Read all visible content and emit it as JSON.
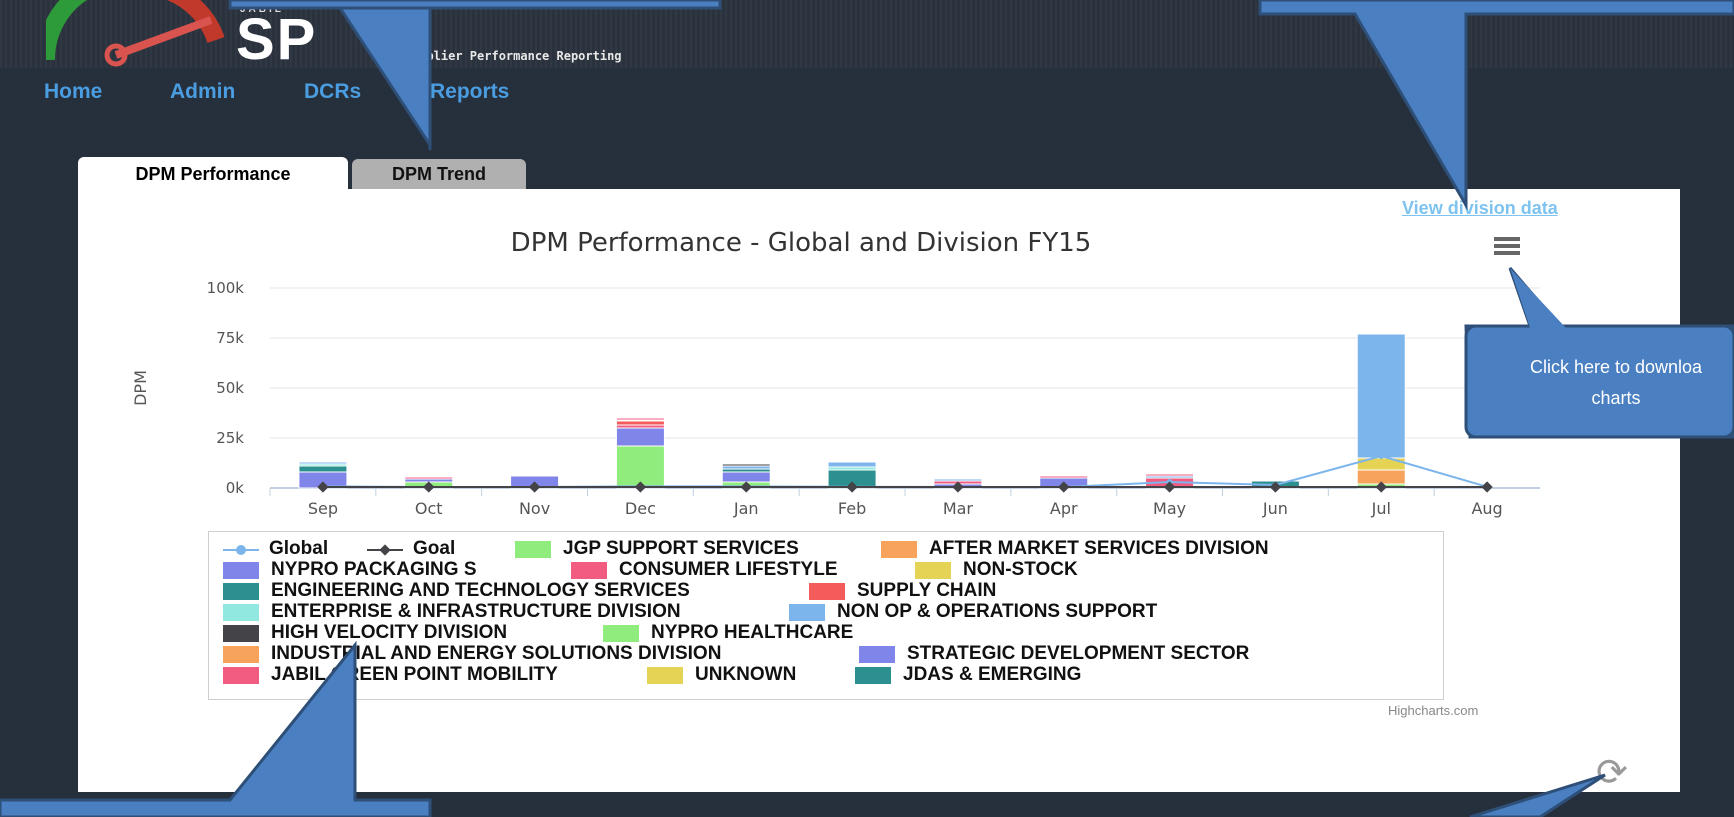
{
  "app": {
    "brand": "SP",
    "brand_company": "JABIL",
    "tagline": "upplier Performance Reporting"
  },
  "nav": {
    "items": [
      "Home",
      "Admin",
      "DCRs",
      "Reports"
    ]
  },
  "tabs": [
    {
      "label": "DPM Performance",
      "active": true
    },
    {
      "label": "DPM Trend",
      "active": false
    }
  ],
  "links": {
    "view_division": "View division data"
  },
  "chart_data": {
    "type": "bar",
    "title": "DPM Performance - Global and Division FY15",
    "ylabel": "DPM",
    "xlabel": "",
    "ylim": [
      0,
      100000
    ],
    "yticks": [
      "0k",
      "25k",
      "50k",
      "75k",
      "100k"
    ],
    "categories": [
      "Sep",
      "Oct",
      "Nov",
      "Dec",
      "Jan",
      "Feb",
      "Mar",
      "Apr",
      "May",
      "Jun",
      "Jul",
      "Aug"
    ],
    "stacked": true,
    "series": [
      {
        "name": "Global",
        "type": "line",
        "color": "#7cb5ec",
        "values": [
          800,
          500,
          500,
          800,
          800,
          600,
          500,
          500,
          3000,
          1500,
          16000,
          600
        ]
      },
      {
        "name": "Goal",
        "type": "line",
        "color": "#434348",
        "values": [
          500,
          500,
          500,
          500,
          500,
          500,
          500,
          500,
          500,
          500,
          500,
          500
        ]
      },
      {
        "name": "JGP SUPPORT SERVICES",
        "color": "#90ed7d",
        "values": [
          0,
          3000,
          0,
          21000,
          3000,
          0,
          0,
          0,
          0,
          0,
          2000,
          0
        ]
      },
      {
        "name": "AFTER MARKET SERVICES DIVISION",
        "color": "#f7a35c",
        "values": [
          0,
          0,
          0,
          0,
          0,
          0,
          0,
          0,
          0,
          0,
          7000,
          0
        ]
      },
      {
        "name": "NYPRO PACKAGING S",
        "color": "#8085e9",
        "values": [
          8000,
          1500,
          6000,
          9000,
          5000,
          0,
          2000,
          5000,
          0,
          0,
          0,
          0
        ]
      },
      {
        "name": "CONSUMER LIFESTYLE",
        "color": "#f15c80",
        "values": [
          0,
          1000,
          0,
          1500,
          0,
          0,
          1500,
          1000,
          5000,
          0,
          0,
          0
        ]
      },
      {
        "name": "NON-STOCK",
        "color": "#e4d354",
        "values": [
          0,
          0,
          0,
          0,
          0,
          0,
          0,
          0,
          0,
          0,
          6000,
          0
        ]
      },
      {
        "name": "ENGINEERING AND TECHNOLOGY SERVICES",
        "color": "#2b908f",
        "values": [
          3000,
          0,
          0,
          0,
          1500,
          9000,
          0,
          0,
          0,
          3500,
          0,
          0
        ]
      },
      {
        "name": "SUPPLY CHAIN",
        "color": "#f45b5b",
        "values": [
          0,
          0,
          0,
          2000,
          0,
          0,
          0,
          0,
          0,
          0,
          0,
          0
        ]
      },
      {
        "name": "ENTERPRISE & INFRASTRUCTURE DIVISION",
        "color": "#91e8e1",
        "values": [
          1000,
          0,
          0,
          0,
          0,
          1500,
          0,
          0,
          0,
          0,
          0,
          0
        ]
      },
      {
        "name": "NON OP & OPERATIONS SUPPORT",
        "color": "#7cb5ec",
        "values": [
          1000,
          500,
          0,
          500,
          1500,
          2500,
          1000,
          0,
          1000,
          0,
          62000,
          0
        ]
      },
      {
        "name": "HIGH VELOCITY DIVISION",
        "color": "#434348",
        "values": [
          0,
          0,
          0,
          0,
          1000,
          0,
          0,
          0,
          0,
          0,
          0,
          0
        ]
      },
      {
        "name": "NYPRO HEALTHCARE",
        "color": "#90ed7d",
        "values": [
          0,
          0,
          0,
          0,
          0,
          0,
          0,
          0,
          0,
          0,
          0,
          0
        ]
      },
      {
        "name": "INDUSTRIAL AND ENERGY SOLUTIONS DIVISION",
        "color": "#f7a35c",
        "values": [
          0,
          0,
          0,
          0,
          0,
          0,
          0,
          0,
          0,
          0,
          0,
          0
        ]
      },
      {
        "name": "STRATEGIC DEVELOPMENT SECTOR",
        "color": "#8085e9",
        "values": [
          0,
          0,
          0,
          0,
          0,
          0,
          0,
          0,
          0,
          0,
          0,
          0
        ]
      },
      {
        "name": "JABIL GREEN POINT MOBILITY",
        "color": "#f15c80",
        "values": [
          0,
          0,
          0,
          1000,
          0,
          0,
          0,
          0,
          1000,
          0,
          0,
          0
        ]
      },
      {
        "name": "UNKNOWN",
        "color": "#e4d354",
        "values": [
          0,
          0,
          0,
          0,
          0,
          0,
          0,
          0,
          0,
          0,
          0,
          0
        ]
      },
      {
        "name": "JDAS & EMERGING",
        "color": "#2b908f",
        "values": [
          0,
          0,
          0,
          0,
          0,
          0,
          0,
          0,
          0,
          0,
          0,
          0
        ]
      }
    ],
    "credit": "Highcharts.com"
  },
  "callout": {
    "text": "Click here to download charts",
    "line1": "Click here to downloa",
    "line2": "charts"
  },
  "icons": {
    "menu": "hamburger-menu-icon",
    "refresh": "refresh-icon"
  }
}
